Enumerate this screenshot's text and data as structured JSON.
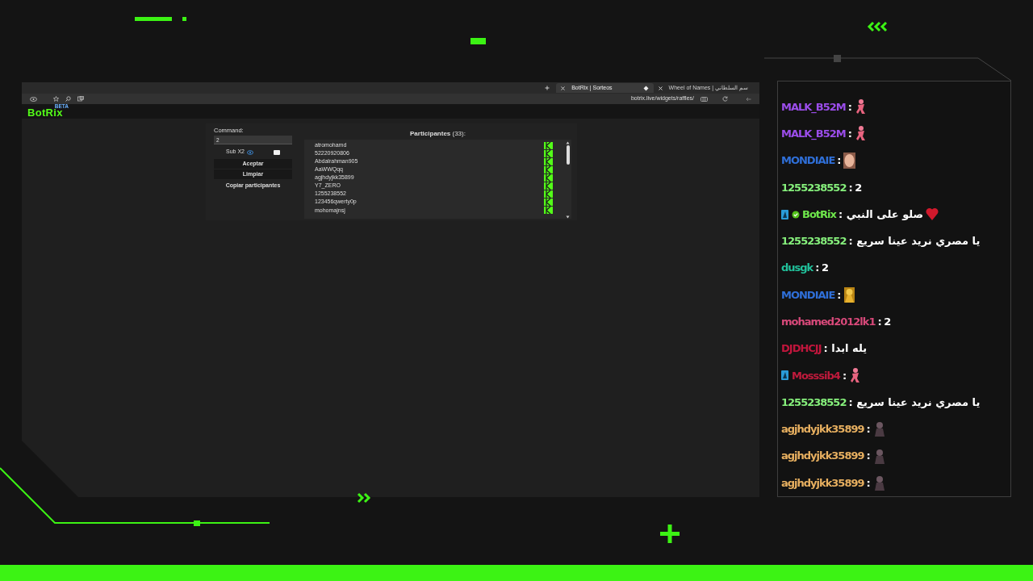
{
  "browser": {
    "tabs": [
      {
        "title": "BotRix | Sorteos",
        "selected": true
      },
      {
        "title": "Wheel of Names | سم السلطاني",
        "selected": false
      }
    ],
    "url": "botrix.live/widgets/raffles/"
  },
  "app": {
    "logo": "BotRix",
    "logo_tag": "BETA"
  },
  "raffle": {
    "command_label": "Command:",
    "command_value": "2",
    "sub_label": "Sub X2",
    "sub_checked": false,
    "buttons": [
      {
        "label": "Aceptar",
        "kind": "filled"
      },
      {
        "label": "Limpiar",
        "kind": "filled"
      },
      {
        "label": "Copiar participantes",
        "kind": "plain"
      }
    ],
    "participants_title": "**Participantes** (33):",
    "participants": [
      "atromohamd",
      "52220920806",
      "Abdalrahman905",
      "AaWWQqq",
      "agjhdyjkk35899",
      "Y7_ZERO",
      "1255238552",
      "123456qwerty0p",
      "mohomajnsj"
    ]
  },
  "chat": [
    {
      "user": "MALK_B52M",
      "color": "#9b4dea",
      "text": ":",
      "emote": {
        "kind": "figure"
      }
    },
    {
      "user": "MALK_B52M",
      "color": "#9b4dea",
      "text": ":",
      "emote": {
        "kind": "figure"
      }
    },
    {
      "user": "MONDIAIE",
      "color": "#2f6fd8",
      "text": ":",
      "emote": {
        "kind": "face"
      }
    },
    {
      "user": "1255238552",
      "color": "#86f07c",
      "text": ": 2"
    },
    {
      "user": "BotRix",
      "color": "#6ee64b",
      "badges": [
        {
          "kind": "staff"
        },
        {
          "kind": "verified"
        }
      ],
      "text": ": صلو على النبي",
      "emote": {
        "kind": "heart"
      }
    },
    {
      "user": "1255238552",
      "color": "#86f07c",
      "text": ": يا مصري نريد عينا سريع"
    },
    {
      "user": "dusgk",
      "color": "#21c19b",
      "text": ": 2"
    },
    {
      "user": "MONDIAIE",
      "color": "#2f6fd8",
      "text": ":",
      "emote": {
        "kind": "gold"
      }
    },
    {
      "user": "mohamed2012lk1",
      "color": "#d8497a",
      "text": ": 2"
    },
    {
      "user": "DJDHCJJ",
      "color": "#c0163c",
      "text": ": يله ابدا"
    },
    {
      "user": "Mosssib4",
      "color": "#c01a3c",
      "badges": [
        {
          "kind": "staff"
        }
      ],
      "text": ":",
      "emote": {
        "kind": "figure"
      }
    },
    {
      "user": "1255238552",
      "color": "#86f07c",
      "text": ": يا مصري نريد عينا سريع"
    },
    {
      "user": "agjhdyjkk35899",
      "color": "#e8b060",
      "text": ":",
      "emote": {
        "kind": "shadow"
      }
    },
    {
      "user": "agjhdyjkk35899",
      "color": "#e8b060",
      "text": ":",
      "emote": {
        "kind": "shadow"
      }
    },
    {
      "user": "agjhdyjkk35899",
      "color": "#e8b060",
      "text": ":",
      "emote": {
        "kind": "shadow"
      }
    }
  ]
}
